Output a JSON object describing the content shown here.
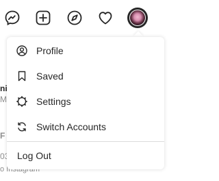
{
  "nav": {
    "icons": [
      "messenger-icon",
      "new-post-icon",
      "explore-icon",
      "activity-heart-icon"
    ],
    "avatar": "profile-avatar"
  },
  "background": {
    "fragment_1": "ni",
    "fragment_2": "Mi",
    "fragment_3": "F",
    "fragment_4": "03",
    "fragment_5": "o Instagram"
  },
  "dropdown": {
    "items": [
      {
        "label": "Profile",
        "icon": "profile-circle-icon"
      },
      {
        "label": "Saved",
        "icon": "bookmark-icon"
      },
      {
        "label": "Settings",
        "icon": "settings-gear-icon"
      },
      {
        "label": "Switch Accounts",
        "icon": "switch-arrows-icon"
      }
    ],
    "logout_label": "Log Out"
  },
  "colors": {
    "text": "#262626",
    "muted": "#8e8e8e",
    "divider": "#dbdbdb"
  }
}
